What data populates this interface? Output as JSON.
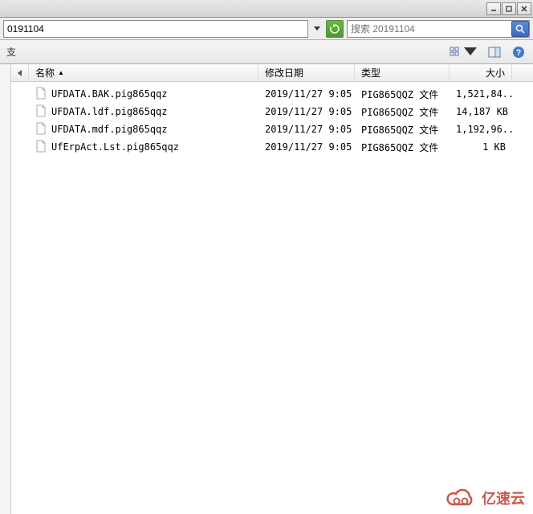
{
  "window": {
    "path": "0191104",
    "search_placeholder": "搜索 20191104"
  },
  "toolbar": {
    "left_fragment": "支"
  },
  "columns": {
    "name": "名称",
    "date": "修改日期",
    "type": "类型",
    "size": "大小"
  },
  "files": [
    {
      "name": "UFDATA.BAK.pig865qqz",
      "date": "2019/11/27 9:05",
      "type": "PIG865QQZ 文件",
      "size": "1,521,84..."
    },
    {
      "name": "UFDATA.ldf.pig865qqz",
      "date": "2019/11/27 9:05",
      "type": "PIG865QQZ 文件",
      "size": "14,187 KB"
    },
    {
      "name": "UFDATA.mdf.pig865qqz",
      "date": "2019/11/27 9:05",
      "type": "PIG865QQZ 文件",
      "size": "1,192,96..."
    },
    {
      "name": "UfErpAct.Lst.pig865qqz",
      "date": "2019/11/27 9:05",
      "type": "PIG865QQZ 文件",
      "size": "1 KB"
    }
  ],
  "watermark": {
    "text": "亿速云"
  }
}
